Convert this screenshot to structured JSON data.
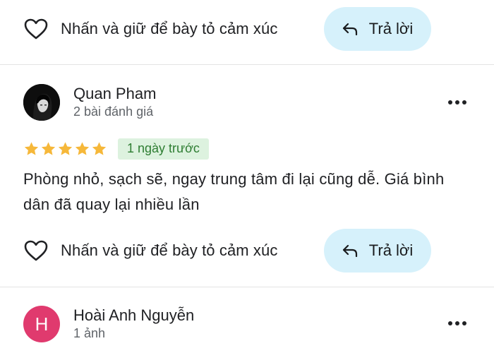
{
  "colors": {
    "reply_button_bg": "#d6f1fb",
    "date_badge_bg": "#ddf2df",
    "date_badge_text": "#2e7d32",
    "star": "#f6b83a",
    "avatar_letter_bg": "#e03a6e"
  },
  "reaction_label": "Nhấn và giữ để bày tỏ cảm xúc",
  "reply_label": "Trả lời",
  "icons": {
    "react": "heart-outline-icon",
    "reply": "reply-arrow-icon",
    "more": "more-horizontal-icon",
    "star": "star-icon"
  },
  "reviews": [
    {
      "author": "Quan Pham",
      "meta": "2 bài đánh giá",
      "avatar": "photo",
      "rating": 5,
      "rating_max": 5,
      "date": "1 ngày trước",
      "text": "Phòng nhỏ, sạch sẽ, ngay trung tâm đi lại cũng dễ. Giá bình dân đã quay lại nhiều lần"
    },
    {
      "author": "Hoài Anh Nguyễn",
      "meta": "1 ảnh",
      "avatar_letter": "H"
    }
  ]
}
